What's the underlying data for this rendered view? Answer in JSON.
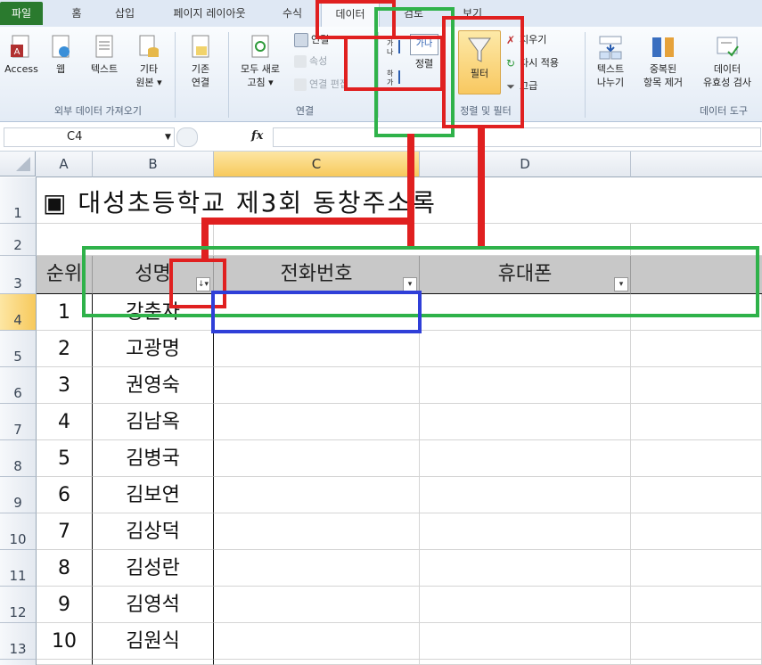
{
  "tabs": [
    "파일",
    "홈",
    "삽입",
    "페이지 레이아웃",
    "수식",
    "데이터",
    "검토",
    "보기"
  ],
  "ribbon": {
    "external_data": {
      "access": "Access",
      "web": "웹",
      "text": "텍스트",
      "other_sources_1": "기타",
      "other_sources_2": "원본",
      "existing_1": "기존",
      "existing_2": "연결",
      "group_label": "외부 데이터 가져오기"
    },
    "connections": {
      "refresh_all_1": "모두 새로",
      "refresh_all_2": "고침",
      "connections": "연결",
      "properties": "속성",
      "edit_links": "연결 편집",
      "group_label": "연결"
    },
    "sort_filter": {
      "sort_az": "가나",
      "sort": "정렬",
      "filter": "필터",
      "clear": "지우기",
      "reapply": "다시 적용",
      "advanced": "고급",
      "group_label": "정렬 및 필터"
    },
    "data_tools": {
      "text_to_columns_1": "텍스트",
      "text_to_columns_2": "나누기",
      "remove_dup_1": "중복된",
      "remove_dup_2": "항목 제거",
      "validation_1": "데이터",
      "validation_2": "유효성 검사",
      "group_label": "데이터 도구"
    }
  },
  "formula_bar": {
    "name_box": "C4",
    "fx": "fx",
    "value": ""
  },
  "columns": [
    "A",
    "B",
    "C",
    "D"
  ],
  "sheet": {
    "title": "▣ 대성초등학교 제3회 동창주소록",
    "headers": [
      "순위",
      "성명",
      "전화번호",
      "휴대폰"
    ],
    "rows": [
      {
        "rank": "1",
        "name": "강춘자"
      },
      {
        "rank": "2",
        "name": "고광명"
      },
      {
        "rank": "3",
        "name": "권영숙"
      },
      {
        "rank": "4",
        "name": "김남옥"
      },
      {
        "rank": "5",
        "name": "김병국"
      },
      {
        "rank": "6",
        "name": "김보연"
      },
      {
        "rank": "7",
        "name": "김상덕"
      },
      {
        "rank": "8",
        "name": "김성란"
      },
      {
        "rank": "9",
        "name": "김영석"
      },
      {
        "rank": "10",
        "name": "김원식"
      }
    ],
    "row_numbers": [
      "1",
      "2",
      "3",
      "4",
      "5",
      "6",
      "7",
      "8",
      "9",
      "10",
      "11",
      "12",
      "13"
    ]
  },
  "colors": {
    "annotation_red": "#e02020",
    "annotation_green": "#2fb24a",
    "annotation_blue": "#2f3fd8",
    "file_tab": "#2a7a2e"
  }
}
